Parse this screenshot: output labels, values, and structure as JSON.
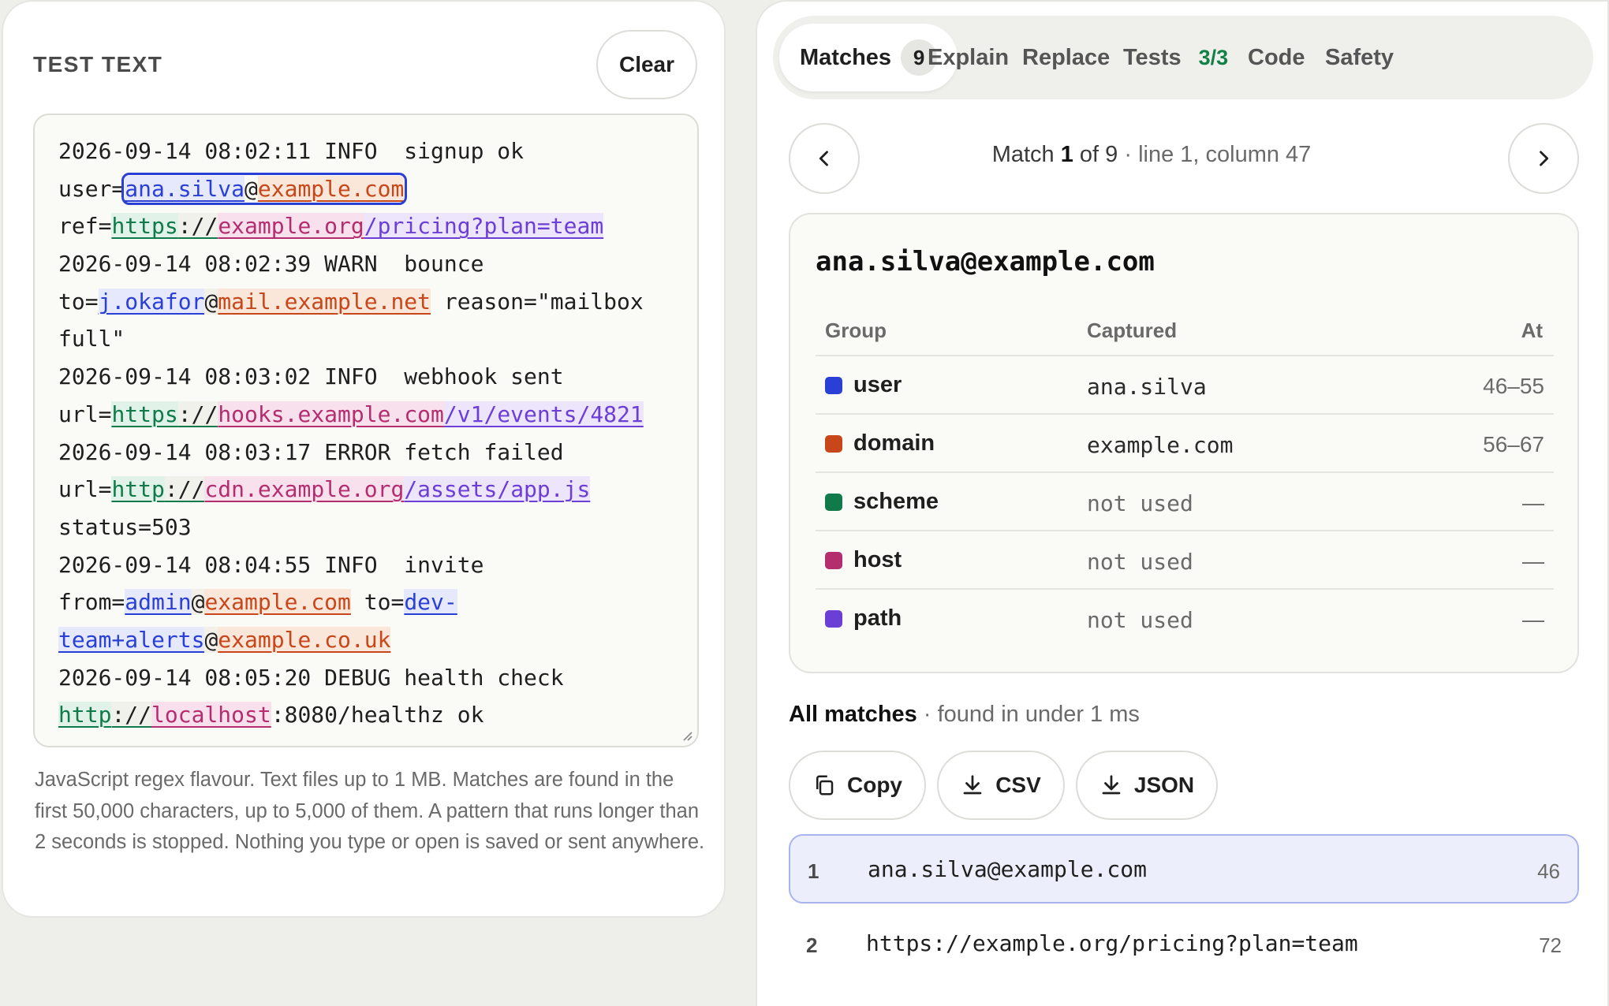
{
  "test_text": {
    "title": "TEST TEXT",
    "clear_label": "Clear",
    "footnote": "JavaScript regex flavour. Text files up to 1 MB. Matches are found in the first 50,000 characters, up to 5,000 of them. A pattern that runs longer than 2 seconds is stopped. Nothing you type or open is saved or sent anywhere.",
    "lines": [
      "2026-09-14 08:02:11 INFO  signup ok",
      "user=ana.silva@example.com",
      "ref=https://example.org/pricing?plan=team",
      "2026-09-14 08:02:39 WARN  bounce",
      "to=j.okafor@mail.example.net reason=\"mailbox",
      "full\"",
      "2026-09-14 08:03:02 INFO  webhook sent",
      "url=https://hooks.example.com/v1/events/4821",
      "2026-09-14 08:03:17 ERROR fetch failed",
      "url=http://cdn.example.org/assets/app.js",
      "status=503",
      "2026-09-14 08:04:55 INFO  invite",
      "from=admin@example.com to=dev-",
      "team+alerts@example.co.uk",
      "2026-09-14 08:05:20 DEBUG health check",
      "http://localhost:8080/healthz ok"
    ]
  },
  "tabs": {
    "matches": "Matches",
    "matches_count": "9",
    "explain": "Explain",
    "replace": "Replace",
    "tests": "Tests",
    "tests_count": "3/3",
    "code": "Code",
    "safety": "Safety"
  },
  "navigator": {
    "prefix": "Match ",
    "index": "1",
    "of": " of 9",
    "location": " · line 1, column 47"
  },
  "detail": {
    "match_text": "ana.silva@example.com",
    "headers": {
      "group": "Group",
      "captured": "Captured",
      "at": "At"
    },
    "groups": [
      {
        "name": "user",
        "captured": "ana.silva",
        "at": "46–55",
        "color": "#2a3fd6"
      },
      {
        "name": "domain",
        "captured": "example.com",
        "at": "56–67",
        "color": "#c7471a"
      },
      {
        "name": "scheme",
        "captured": "not used",
        "at": "—",
        "color": "#117a4a"
      },
      {
        "name": "host",
        "captured": "not used",
        "at": "—",
        "color": "#b42d6e"
      },
      {
        "name": "path",
        "captured": "not used",
        "at": "—",
        "color": "#6b3fd6"
      }
    ]
  },
  "all_matches": {
    "title": "All matches",
    "subtitle": " · found in under 1 ms",
    "copy_label": "Copy",
    "csv_label": "CSV",
    "json_label": "JSON",
    "items": [
      {
        "num": "1",
        "value": "ana.silva@example.com",
        "at": "46"
      },
      {
        "num": "2",
        "value": "https://example.org/pricing?plan=team",
        "at": "72"
      }
    ]
  },
  "colors": {
    "user": "#2a3fd6",
    "domain": "#c7471a",
    "scheme": "#117a4a",
    "host": "#b42d6e",
    "path": "#6b3fd6",
    "tests_ok": "#138048"
  },
  "icons": {
    "prev": "chevron-left-icon",
    "next": "chevron-right-icon",
    "copy": "copy-icon",
    "csv": "download-icon",
    "json": "download-icon"
  }
}
